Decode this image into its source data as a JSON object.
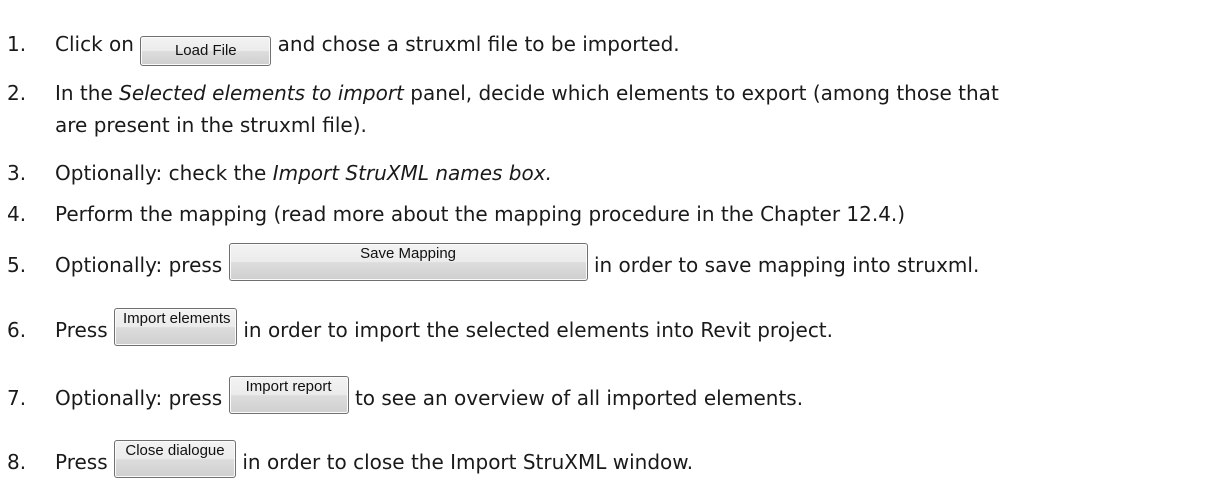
{
  "steps": [
    {
      "num": "1.",
      "before": "Click on",
      "button": "Load File",
      "after": "and chose a struxml file to be imported."
    },
    {
      "num": "2.",
      "before": "In the",
      "italic": "Selected elements to import",
      "after": "panel, decide which elements to export (among those that",
      "cont": "are present in the struxml file)."
    },
    {
      "num": "3.",
      "before": "Optionally: check the",
      "italic": "Import StruXML names box."
    },
    {
      "num": "4.",
      "text": "Perform the mapping (read more about the mapping procedure in the Chapter 12.4.)"
    },
    {
      "num": "5.",
      "before": "Optionally: press",
      "button": "Save Mapping",
      "after": "in order to save mapping into struxml."
    },
    {
      "num": "6.",
      "before": "Press",
      "button": "Import elements",
      "after": "in order to import the selected elements into Revit project."
    },
    {
      "num": "7.",
      "before": "Optionally: press",
      "button": "Import report",
      "after": "to see an overview of all imported elements."
    },
    {
      "num": "8.",
      "before": "Press",
      "button": "Close dialogue",
      "after": "in order to close the Import StruXML window."
    }
  ]
}
